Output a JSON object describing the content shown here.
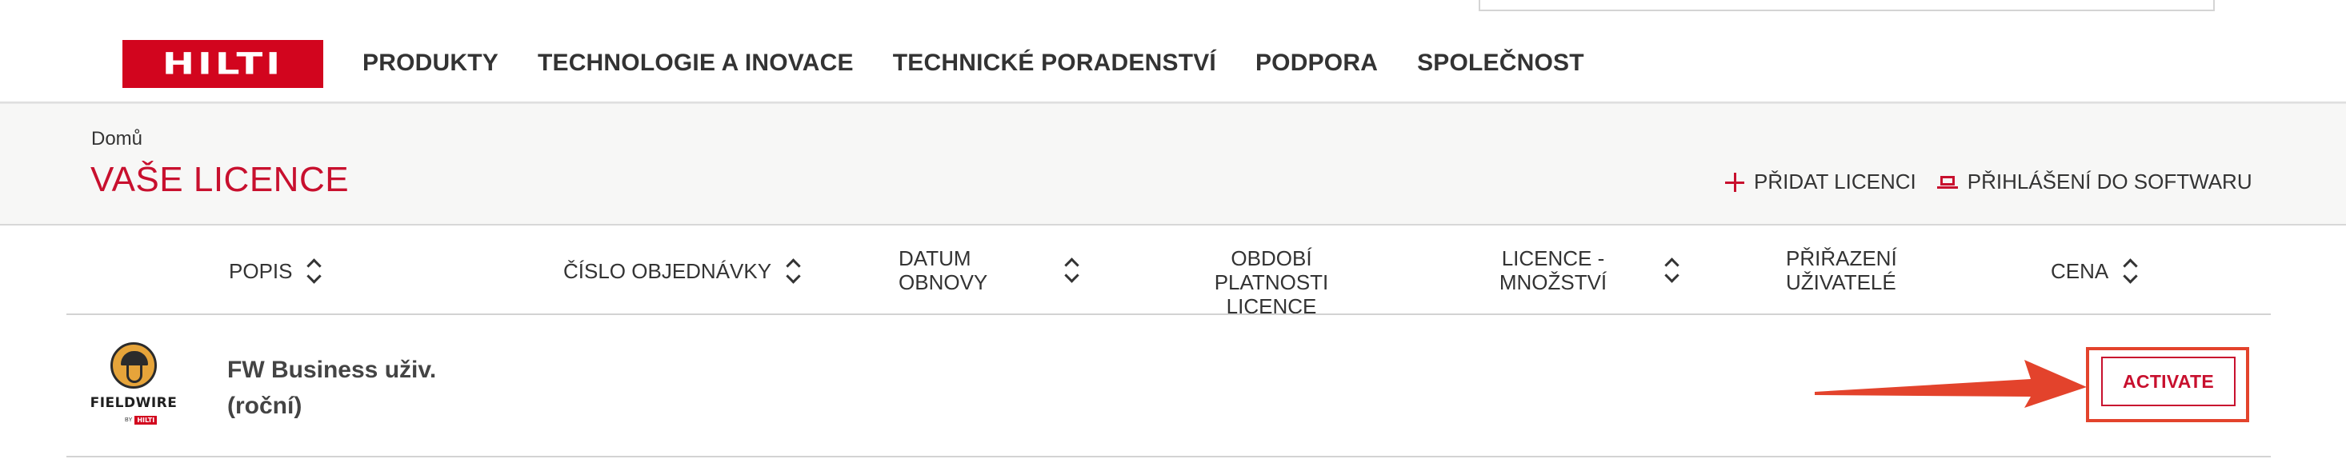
{
  "header": {
    "logo_text": "HILTI",
    "nav": [
      "PRODUKTY",
      "TECHNOLOGIE A INOVACE",
      "TECHNICKÉ PORADENSTVÍ",
      "PODPORA",
      "SPOLEČNOST"
    ]
  },
  "page": {
    "breadcrumb": "Domů",
    "title": "VAŠE LICENCE",
    "actions": {
      "add_license": "PŘIDAT LICENCI",
      "software_login": "PŘIHLÁŠENÍ DO SOFTWARU"
    }
  },
  "table": {
    "columns": {
      "description": "POPIS",
      "order_number": "ČÍSLO OBJEDNÁVKY",
      "renewal_date_1": "DATUM",
      "renewal_date_2": "OBNOVY",
      "validity_period_1": "OBDOBÍ PLATNOSTI",
      "validity_period_2": "LICENCE",
      "quantity_1": "LICENCE -",
      "quantity_2": "MNOŽSTVÍ",
      "user_assignment_1": "PŘIŘAZENÍ",
      "user_assignment_2": "UŽIVATELÉ",
      "price": "CENA"
    },
    "rows": [
      {
        "product_logo": "FIELDWIRE",
        "product_logo_by": "BY",
        "product_logo_brand": "HILTI",
        "name_line1": "FW Business uživ.",
        "name_line2": "(roční)",
        "action_label": "ACTIVATE"
      }
    ]
  },
  "colors": {
    "brand_red": "#d2051e",
    "title_red": "#c8102e",
    "annotation_red": "#e3432c"
  },
  "icons": [
    "plus-icon",
    "laptop-icon",
    "sort-icon",
    "fieldwire-logo",
    "annotation-arrow"
  ]
}
